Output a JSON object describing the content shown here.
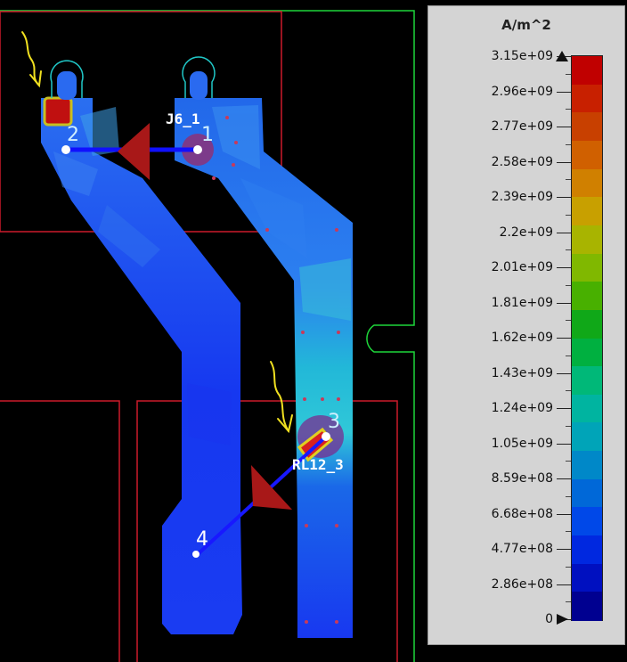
{
  "viewport": {
    "refdes_top": "J6_1",
    "refdes_bottom": "RL12_3",
    "pin_labels": [
      "1",
      "2",
      "3",
      "4"
    ]
  },
  "legend": {
    "unit": "A/m^2",
    "ticks": [
      "3.15e+09",
      "2.96e+09",
      "2.77e+09",
      "2.58e+09",
      "2.39e+09",
      "2.2e+09",
      "2.01e+09",
      "1.81e+09",
      "1.62e+09",
      "1.43e+09",
      "1.24e+09",
      "1.05e+09",
      "8.59e+08",
      "6.68e+08",
      "4.77e+08",
      "2.86e+08",
      "0"
    ],
    "colors": [
      "#000090",
      "#0010c0",
      "#0028e0",
      "#0048e8",
      "#0068d8",
      "#0088c8",
      "#00a4b8",
      "#00b4a0",
      "#00b878",
      "#00b040",
      "#10a818",
      "#48b000",
      "#80b800",
      "#a8b400",
      "#c8a000",
      "#d08000",
      "#d06000",
      "#c84000",
      "#c82000",
      "#c00000"
    ]
  }
}
